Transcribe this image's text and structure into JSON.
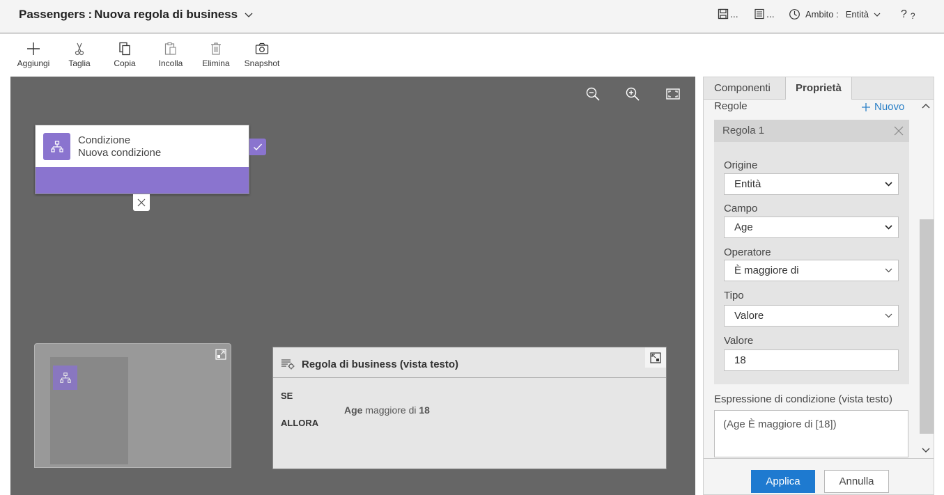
{
  "header": {
    "entity": "Passengers",
    "separator": ":",
    "title": "Nuova regola di business",
    "save_label": "...",
    "list_label": "...",
    "scope_label": "Ambito :",
    "scope_value": "Entità",
    "help_label": "?"
  },
  "toolbar": {
    "add": "Aggiungi",
    "cut": "Taglia",
    "copy": "Copia",
    "paste": "Incolla",
    "delete": "Elimina",
    "snapshot": "Snapshot"
  },
  "canvas": {
    "condition": {
      "type_label": "Condizione",
      "name": "Nuova condizione"
    },
    "text_view": {
      "title": "Regola di business (vista testo)",
      "if_label": "SE",
      "field": "Age",
      "operator_text": "maggiore di",
      "value": "18",
      "then_label": "ALLORA"
    }
  },
  "panel": {
    "tabs": [
      {
        "label": "Componenti",
        "active": false
      },
      {
        "label": "Proprietà",
        "active": true
      }
    ],
    "rules_label": "Regole",
    "new_label": "Nuovo",
    "rule": {
      "title": "Regola 1",
      "fields": {
        "origin": {
          "label": "Origine",
          "value": "Entità"
        },
        "field": {
          "label": "Campo",
          "value": "Age"
        },
        "operator": {
          "label": "Operatore",
          "value": "È maggiore di"
        },
        "type": {
          "label": "Tipo",
          "value": "Valore"
        },
        "value": {
          "label": "Valore",
          "value": "18"
        }
      }
    },
    "expression_label": "Espressione di condizione (vista testo)",
    "expression_value": "(Age È maggiore di [18])",
    "apply_label": "Applica",
    "cancel_label": "Annulla"
  },
  "colors": {
    "accent_purple": "#8a74cf",
    "primary_blue": "#1e7ad0",
    "link_blue": "#2a7fc6",
    "canvas_gray": "#666666"
  }
}
